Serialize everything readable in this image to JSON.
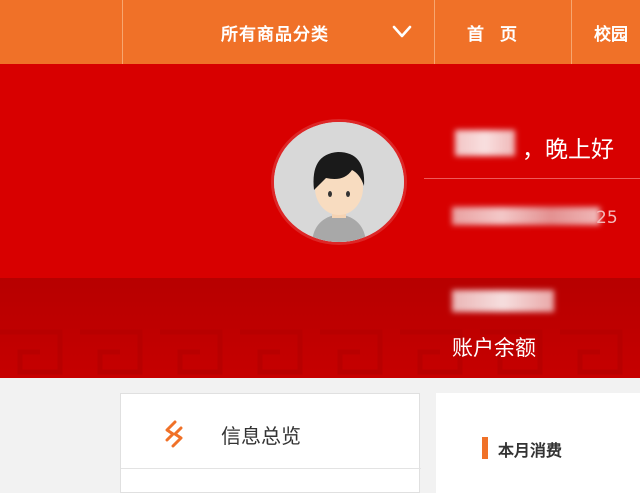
{
  "nav": {
    "category_label": "所有商品分类",
    "home_label": "首页",
    "campus_label": "校园"
  },
  "profile": {
    "greeting": "，晚上好",
    "id_suffix": "25",
    "balance_label": "账户余额"
  },
  "overview": {
    "label": "信息总览"
  },
  "summary": {
    "month_label": "本月消费"
  },
  "colors": {
    "nav_orange": "#f07128",
    "banner_red": "#d80000",
    "accent_orange": "#f07128"
  },
  "icons": {
    "category_toggle": "chevron-down-icon",
    "overview": "overview-icon"
  }
}
